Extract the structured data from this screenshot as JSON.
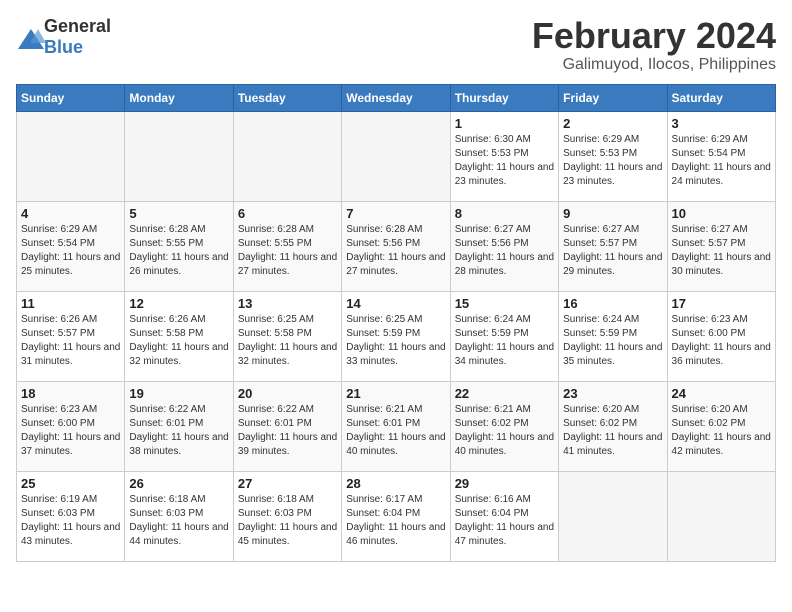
{
  "header": {
    "logo_general": "General",
    "logo_blue": "Blue",
    "month_title": "February 2024",
    "location": "Galimuyod, Ilocos, Philippines"
  },
  "days_of_week": [
    "Sunday",
    "Monday",
    "Tuesday",
    "Wednesday",
    "Thursday",
    "Friday",
    "Saturday"
  ],
  "weeks": [
    [
      {
        "day": "",
        "info": ""
      },
      {
        "day": "",
        "info": ""
      },
      {
        "day": "",
        "info": ""
      },
      {
        "day": "",
        "info": ""
      },
      {
        "day": "1",
        "info": "Sunrise: 6:30 AM\nSunset: 5:53 PM\nDaylight: 11 hours and 23 minutes."
      },
      {
        "day": "2",
        "info": "Sunrise: 6:29 AM\nSunset: 5:53 PM\nDaylight: 11 hours and 23 minutes."
      },
      {
        "day": "3",
        "info": "Sunrise: 6:29 AM\nSunset: 5:54 PM\nDaylight: 11 hours and 24 minutes."
      }
    ],
    [
      {
        "day": "4",
        "info": "Sunrise: 6:29 AM\nSunset: 5:54 PM\nDaylight: 11 hours and 25 minutes."
      },
      {
        "day": "5",
        "info": "Sunrise: 6:28 AM\nSunset: 5:55 PM\nDaylight: 11 hours and 26 minutes."
      },
      {
        "day": "6",
        "info": "Sunrise: 6:28 AM\nSunset: 5:55 PM\nDaylight: 11 hours and 27 minutes."
      },
      {
        "day": "7",
        "info": "Sunrise: 6:28 AM\nSunset: 5:56 PM\nDaylight: 11 hours and 27 minutes."
      },
      {
        "day": "8",
        "info": "Sunrise: 6:27 AM\nSunset: 5:56 PM\nDaylight: 11 hours and 28 minutes."
      },
      {
        "day": "9",
        "info": "Sunrise: 6:27 AM\nSunset: 5:57 PM\nDaylight: 11 hours and 29 minutes."
      },
      {
        "day": "10",
        "info": "Sunrise: 6:27 AM\nSunset: 5:57 PM\nDaylight: 11 hours and 30 minutes."
      }
    ],
    [
      {
        "day": "11",
        "info": "Sunrise: 6:26 AM\nSunset: 5:57 PM\nDaylight: 11 hours and 31 minutes."
      },
      {
        "day": "12",
        "info": "Sunrise: 6:26 AM\nSunset: 5:58 PM\nDaylight: 11 hours and 32 minutes."
      },
      {
        "day": "13",
        "info": "Sunrise: 6:25 AM\nSunset: 5:58 PM\nDaylight: 11 hours and 32 minutes."
      },
      {
        "day": "14",
        "info": "Sunrise: 6:25 AM\nSunset: 5:59 PM\nDaylight: 11 hours and 33 minutes."
      },
      {
        "day": "15",
        "info": "Sunrise: 6:24 AM\nSunset: 5:59 PM\nDaylight: 11 hours and 34 minutes."
      },
      {
        "day": "16",
        "info": "Sunrise: 6:24 AM\nSunset: 5:59 PM\nDaylight: 11 hours and 35 minutes."
      },
      {
        "day": "17",
        "info": "Sunrise: 6:23 AM\nSunset: 6:00 PM\nDaylight: 11 hours and 36 minutes."
      }
    ],
    [
      {
        "day": "18",
        "info": "Sunrise: 6:23 AM\nSunset: 6:00 PM\nDaylight: 11 hours and 37 minutes."
      },
      {
        "day": "19",
        "info": "Sunrise: 6:22 AM\nSunset: 6:01 PM\nDaylight: 11 hours and 38 minutes."
      },
      {
        "day": "20",
        "info": "Sunrise: 6:22 AM\nSunset: 6:01 PM\nDaylight: 11 hours and 39 minutes."
      },
      {
        "day": "21",
        "info": "Sunrise: 6:21 AM\nSunset: 6:01 PM\nDaylight: 11 hours and 40 minutes."
      },
      {
        "day": "22",
        "info": "Sunrise: 6:21 AM\nSunset: 6:02 PM\nDaylight: 11 hours and 40 minutes."
      },
      {
        "day": "23",
        "info": "Sunrise: 6:20 AM\nSunset: 6:02 PM\nDaylight: 11 hours and 41 minutes."
      },
      {
        "day": "24",
        "info": "Sunrise: 6:20 AM\nSunset: 6:02 PM\nDaylight: 11 hours and 42 minutes."
      }
    ],
    [
      {
        "day": "25",
        "info": "Sunrise: 6:19 AM\nSunset: 6:03 PM\nDaylight: 11 hours and 43 minutes."
      },
      {
        "day": "26",
        "info": "Sunrise: 6:18 AM\nSunset: 6:03 PM\nDaylight: 11 hours and 44 minutes."
      },
      {
        "day": "27",
        "info": "Sunrise: 6:18 AM\nSunset: 6:03 PM\nDaylight: 11 hours and 45 minutes."
      },
      {
        "day": "28",
        "info": "Sunrise: 6:17 AM\nSunset: 6:04 PM\nDaylight: 11 hours and 46 minutes."
      },
      {
        "day": "29",
        "info": "Sunrise: 6:16 AM\nSunset: 6:04 PM\nDaylight: 11 hours and 47 minutes."
      },
      {
        "day": "",
        "info": ""
      },
      {
        "day": "",
        "info": ""
      }
    ]
  ]
}
